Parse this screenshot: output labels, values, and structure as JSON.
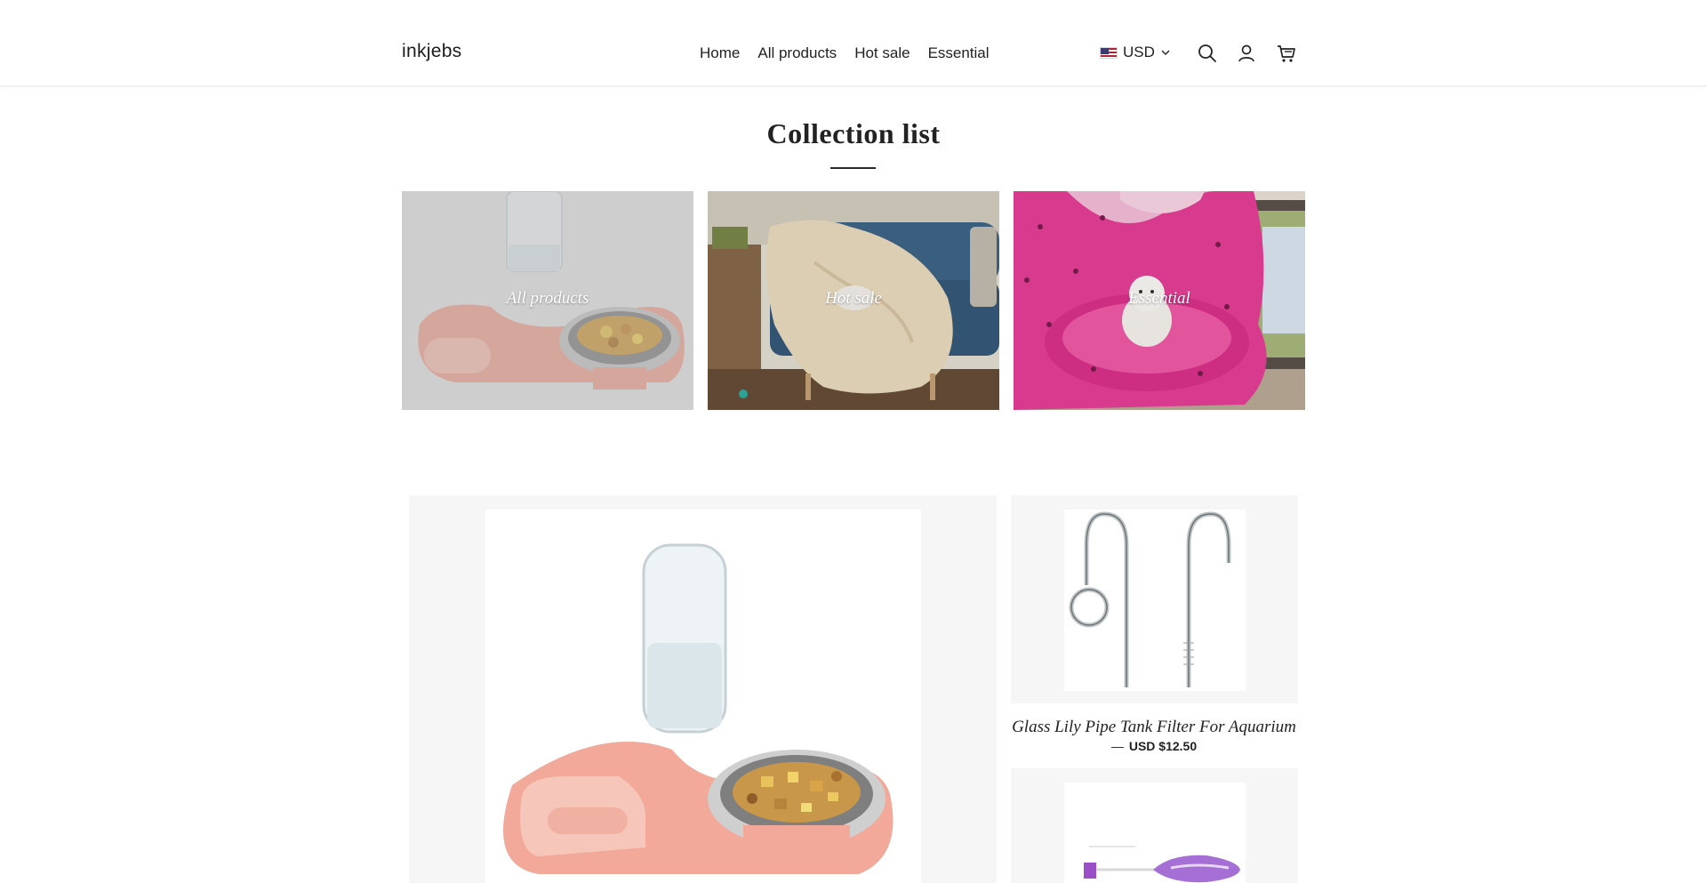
{
  "header": {
    "logo": "inkjebs",
    "nav": [
      "Home",
      "All products",
      "Hot sale",
      "Essential"
    ],
    "currency": "USD",
    "icons": [
      "search-icon",
      "account-icon",
      "cart-icon"
    ]
  },
  "collection": {
    "title": "Collection list",
    "tiles": [
      {
        "label": "All products",
        "image": "pink pet feeder with water bottle"
      },
      {
        "label": "Hot sale",
        "image": "dog under blanket on blue sofa"
      },
      {
        "label": "Essential",
        "image": "puppy in pink pet bed"
      }
    ]
  },
  "featured": {
    "products": [
      {
        "title": "Glass Lily Pipe Tank Filter For Aquarium",
        "dash": "—",
        "price": "USD $12.50"
      }
    ]
  },
  "colors": {
    "accent_pink": "#f2a99a",
    "tile_pink": "#e43e95",
    "sofa_blue": "#3f6688",
    "panel_gray": "#f6f6f6"
  }
}
